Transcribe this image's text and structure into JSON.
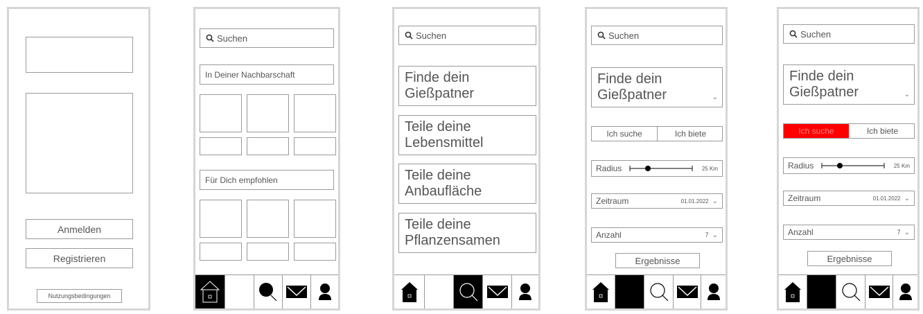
{
  "screen1": {
    "login_label": "Anmelden",
    "register_label": "Registrieren",
    "terms_label": "Nutzungsbedingungen"
  },
  "screen2": {
    "search_placeholder": "Suchen",
    "section1_label": "In Deiner Nachbarschaft",
    "section2_label": "Für Dich empfohlen"
  },
  "screen3": {
    "search_placeholder": "Suchen",
    "cards": [
      "Finde dein Gießpatner",
      "Teile deine Lebensmittel",
      "Teile deine Anbaufläche",
      "Teile deine Pflanzensamen"
    ]
  },
  "screen4": {
    "search_placeholder": "Suchen",
    "title": "Finde dein Gießpatner",
    "seek_label": "Ich suche",
    "offer_label": "Ich biete",
    "radius_label": "Radius",
    "radius_value": "25 Km",
    "period_label": "Zeitraum",
    "period_value": "01.01.2022",
    "count_label": "Anzahl",
    "count_value": "7",
    "results_label": "Ergebnisse"
  },
  "screen5": {
    "search_placeholder": "Suchen",
    "title": "Finde dein Gießpatner",
    "seek_label": "Ich suche",
    "offer_label": "Ich biete",
    "radius_label": "Radius",
    "radius_value": "25 Km",
    "period_label": "Zeitraum",
    "period_value": "01.01.2022",
    "count_label": "Anzahl",
    "count_value": "7",
    "results_label": "Ergebnisse"
  },
  "colors": {
    "accent_red": "#ff0000",
    "border": "#9a9a9a",
    "frame": "#d6d6d6"
  },
  "icons": [
    "home-icon",
    "search-icon",
    "mail-icon",
    "profile-icon",
    "chevron-down-icon"
  ]
}
